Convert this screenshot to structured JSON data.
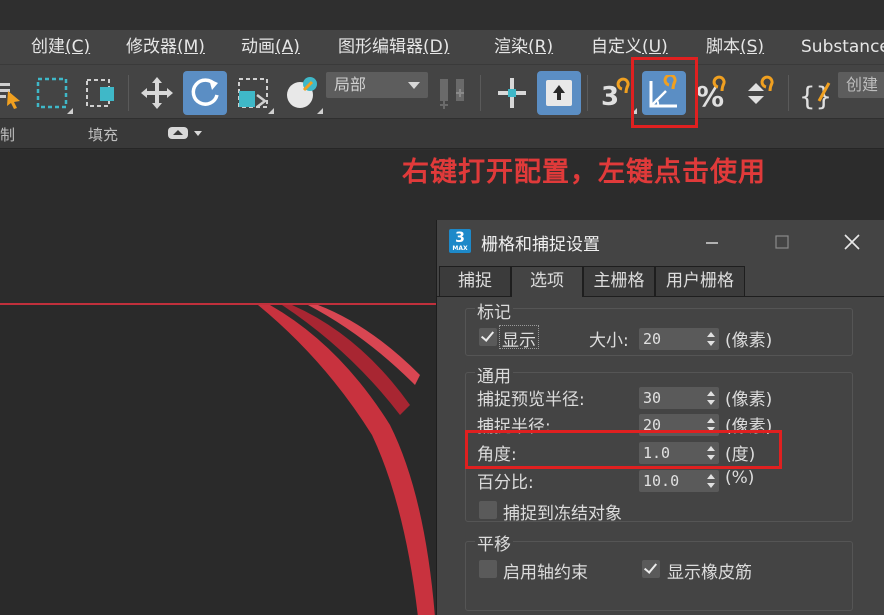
{
  "menu": {
    "items": [
      {
        "label": "创建",
        "key": "(C)"
      },
      {
        "label": "修改器",
        "key": "(M)"
      },
      {
        "label": "动画",
        "key": "(A)"
      },
      {
        "label": "图形编辑器",
        "key": "(D)"
      },
      {
        "label": "渲染",
        "key": "(R)"
      },
      {
        "label": "自定义",
        "key": "(U)"
      },
      {
        "label": "脚本",
        "key": "(S)"
      },
      {
        "label": "Substance",
        "key": ""
      }
    ]
  },
  "toolbar": {
    "coord_dropdown": "局部",
    "create_selection": "创建",
    "snap_toggle_glyph": "3",
    "percent_snap_glyph": "%",
    "spinner_snap_glyph": "⬍",
    "brace_glyph": "{}"
  },
  "ribbon": {
    "left_label": "制",
    "fill_label": "填充"
  },
  "annotation": {
    "text": "右键打开配置，左键点击使用"
  },
  "dialog": {
    "app_icon": "3",
    "app_icon_sub": "MAX",
    "title": "栅格和捕捉设置",
    "tabs": [
      "捕捉",
      "选项",
      "主栅格",
      "用户栅格"
    ],
    "selected_tab": "选项",
    "markers": {
      "group": "标记",
      "show_label": "显示",
      "show_checked": true,
      "size_label": "大小:",
      "size_value": "20",
      "size_unit": "(像素)"
    },
    "general": {
      "group": "通用",
      "preview_radius_label": "捕捉预览半径:",
      "preview_radius_value": "30",
      "preview_radius_unit": "(像素)",
      "snap_radius_label": "捕捉半径:",
      "snap_radius_value": "20",
      "snap_radius_unit": "(像素)",
      "angle_label": "角度:",
      "angle_value": "1.0",
      "angle_unit": "(度)",
      "percent_label": "百分比:",
      "percent_value": "10.0",
      "percent_unit": "(%)",
      "snap_frozen_label": "捕捉到冻结对象",
      "snap_frozen_checked": false
    },
    "translation": {
      "group": "平移",
      "axis_constraint_label": "启用轴约束",
      "axis_constraint_checked": false,
      "rubber_band_label": "显示橡皮筋",
      "rubber_band_checked": true
    }
  },
  "colors": {
    "accent_blue": "#5b8ec4",
    "highlight_red": "#e02020",
    "snap_orange": "#f0a020"
  }
}
